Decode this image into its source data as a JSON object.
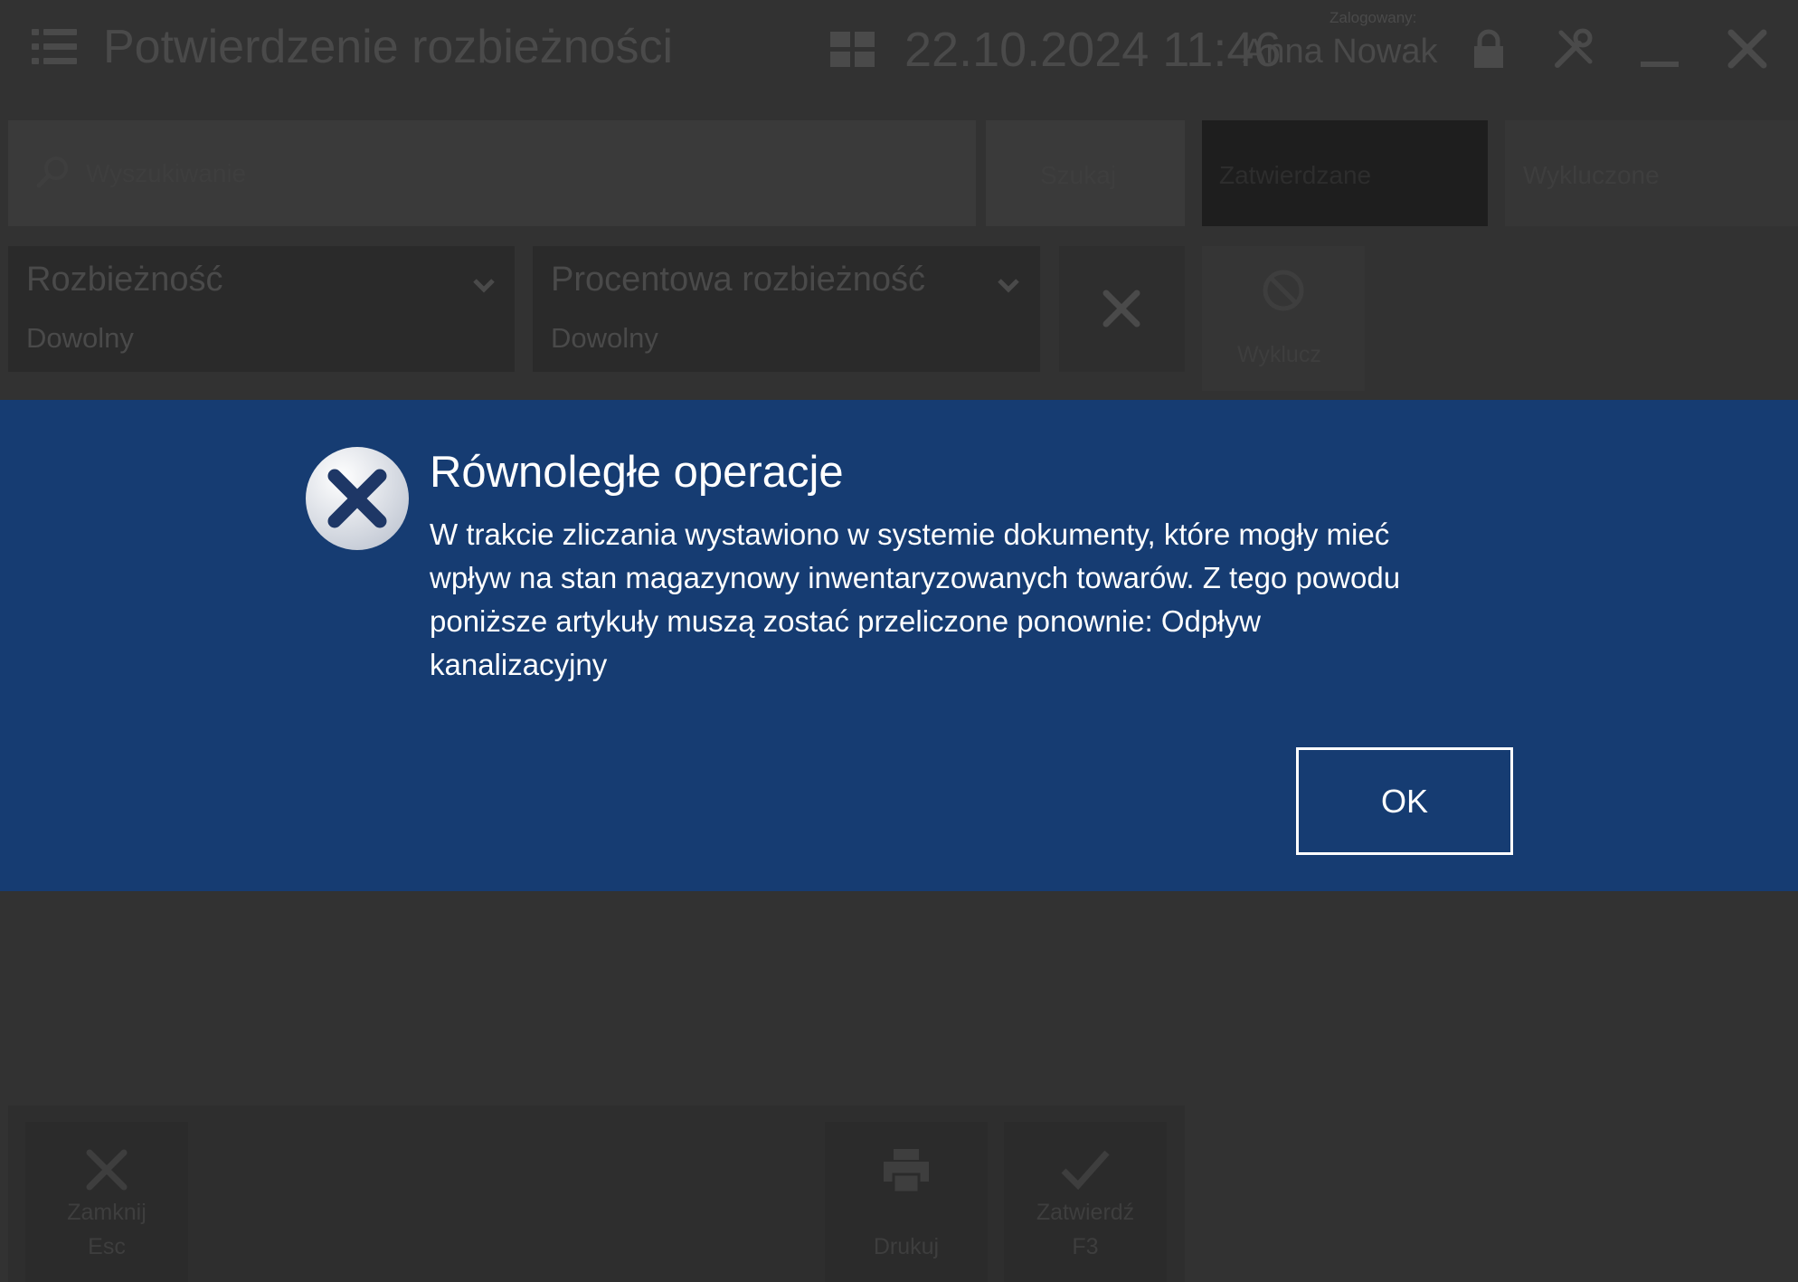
{
  "header": {
    "title": "Potwierdzenie rozbieżności",
    "datetime": "22.10.2024 11:46",
    "logged_in_label": "Zalogowany:",
    "user_name": "Anna Nowak"
  },
  "toolbar": {
    "search_placeholder": "Wyszukiwanie",
    "search_button": "Szukaj",
    "tab_approved": "Zatwierdzane",
    "tab_excluded": "Wykluczone"
  },
  "filters": [
    {
      "title": "Rozbieżność",
      "value": "Dowolny"
    },
    {
      "title": "Procentowa rozbieżność",
      "value": "Dowolny"
    }
  ],
  "exclude_button": "Wyklucz",
  "bottom_buttons": {
    "close_label": "Zamknij",
    "close_shortcut": "Esc",
    "print_label": "Drukuj",
    "approve_label": "Zatwierdź",
    "approve_shortcut": "F3"
  },
  "dialog": {
    "title": "Równoległe operacje",
    "message_lines": [
      "W trakcie zliczania wystawiono w systemie dokumenty, które mogły mieć",
      "wpływ na stan magazynowy inwentaryzowanych towarów. Z tego powodu",
      "poniższe artykuły muszą zostać przeliczone ponownie: Odpływ",
      "kanalizacyjny"
    ],
    "ok_label": "OK"
  },
  "colors": {
    "background": "#323232",
    "dialog_background": "#163c72",
    "dialog_text": "#ffffff",
    "dimmed_text": "#4a4a4a"
  },
  "icons": [
    "menu-icon",
    "tiles-icon",
    "lock-icon",
    "tools-icon",
    "minimize-icon",
    "close-icon",
    "search-icon",
    "chevron-down-icon",
    "clear-filter-icon",
    "exclude-icon",
    "error-icon",
    "printer-icon",
    "checkmark-icon"
  ]
}
